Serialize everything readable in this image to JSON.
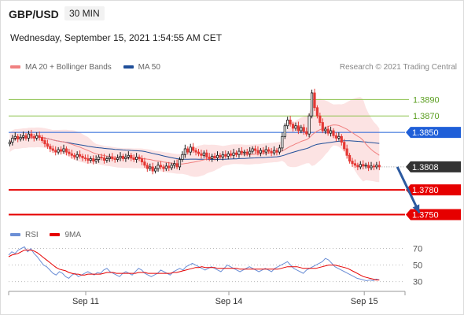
{
  "header": {
    "symbol": "GBP/USD",
    "timeframe": "30 MIN",
    "datetime": "Wednesday, September 15, 2021 1:54:55 AM CET",
    "credit": "Research © 2021 Trading Central"
  },
  "colors": {
    "bollinger_band": "#f9c0c0",
    "ma20": "#f08080",
    "ma50": "#1f4e99",
    "resistance": "#8cc14c",
    "pivot": "#1f5fd8",
    "support": "#e60000",
    "last_price": "#333333",
    "rsi": "#6c8fd6",
    "rsi_ma": "#e60000",
    "arrow": "#2c5aa0",
    "candle_up": "#1a1a1a",
    "candle_down": "#e53935"
  },
  "chart_data": [
    {
      "type": "line",
      "chart": "price",
      "kind": "candlestick",
      "legend": [
        {
          "name": "MA 20 + Bollinger Bands",
          "color": "#f08080"
        },
        {
          "name": "MA 50",
          "color": "#1f4e99"
        }
      ],
      "x_ticks": [
        {
          "label": "Sep 11",
          "t": 70
        },
        {
          "label": "Sep 14",
          "t": 200
        },
        {
          "label": "Sep 15",
          "t": 323
        }
      ],
      "t_range": [
        0,
        360
      ],
      "ylim": [
        1.3738,
        1.392
      ],
      "close": [
        1.3838,
        1.3843,
        1.3845,
        1.3842,
        1.3844,
        1.3846,
        1.3843,
        1.3848,
        1.3845,
        1.3843,
        1.3846,
        1.3844,
        1.384,
        1.3836,
        1.3833,
        1.383,
        1.3828,
        1.3826,
        1.3829,
        1.3827,
        1.383,
        1.3826,
        1.3824,
        1.3822,
        1.382,
        1.3823,
        1.3821,
        1.3819,
        1.3818,
        1.3816,
        1.3818,
        1.3815,
        1.3817,
        1.382,
        1.3819,
        1.3816,
        1.3818,
        1.382,
        1.3818,
        1.3817,
        1.3819,
        1.3821,
        1.3818,
        1.382,
        1.3822,
        1.3819,
        1.3817,
        1.382,
        1.3818,
        1.3814,
        1.381,
        1.3806,
        1.3808,
        1.3803,
        1.3806,
        1.381,
        1.3808,
        1.3806,
        1.3809,
        1.3807,
        1.381,
        1.3812,
        1.3808,
        1.3817,
        1.3823,
        1.383,
        1.3826,
        1.3832,
        1.3828,
        1.3826,
        1.3824,
        1.3822,
        1.3825,
        1.382,
        1.3818,
        1.3821,
        1.3819,
        1.3822,
        1.382,
        1.3823,
        1.3821,
        1.3824,
        1.3822,
        1.3825,
        1.3823,
        1.3827,
        1.3825,
        1.3826,
        1.3824,
        1.3827,
        1.383,
        1.3828,
        1.3825,
        1.3828,
        1.3826,
        1.3829,
        1.3827,
        1.3825,
        1.3828,
        1.3826,
        1.3831,
        1.3845,
        1.3858,
        1.3865,
        1.386,
        1.3855,
        1.3858,
        1.3852,
        1.3856,
        1.3851,
        1.3848,
        1.387,
        1.3898,
        1.388,
        1.387,
        1.3862,
        1.3852,
        1.3854,
        1.3849,
        1.3852,
        1.3846,
        1.3843,
        1.3845,
        1.3838,
        1.383,
        1.3822,
        1.3815,
        1.3812,
        1.381,
        1.3808,
        1.3811,
        1.3809,
        1.381,
        1.3807,
        1.3809,
        1.3808,
        1.381,
        1.3808
      ],
      "levels": [
        {
          "value": 1.389,
          "label": "1.3890",
          "kind": "resistance"
        },
        {
          "value": 1.387,
          "label": "1.3870",
          "kind": "resistance"
        },
        {
          "value": 1.385,
          "label": "1.3850",
          "kind": "pivot"
        },
        {
          "value": 1.3808,
          "label": "1.3808",
          "kind": "last"
        },
        {
          "value": 1.378,
          "label": "1.3780",
          "kind": "support"
        },
        {
          "value": 1.375,
          "label": "1.3750",
          "kind": "support"
        }
      ],
      "forecast_arrow": {
        "from": {
          "t": 353,
          "y": 1.3808
        },
        "to": {
          "t": 373,
          "y": 1.3752
        }
      }
    },
    {
      "type": "line",
      "chart": "rsi",
      "legend": [
        {
          "name": "RSI",
          "color": "#6c8fd6"
        },
        {
          "name": "9MA",
          "color": "#e60000"
        }
      ],
      "ylim": [
        22,
        80
      ],
      "y_ticks": [
        70,
        50,
        30
      ],
      "rsi": [
        62,
        66,
        64,
        68,
        70,
        72,
        66,
        70,
        64,
        60,
        55,
        50,
        48,
        44,
        40,
        38,
        42,
        40,
        36,
        34,
        38,
        40,
        36,
        38,
        40,
        42,
        40,
        38,
        41,
        40,
        44,
        46,
        42,
        40,
        38,
        36,
        40,
        42,
        40,
        38,
        42,
        46,
        44,
        40,
        38,
        36,
        38,
        40,
        44,
        42,
        40,
        38,
        42,
        44,
        46,
        44,
        48,
        50,
        52,
        50,
        48,
        46,
        44,
        46,
        48,
        46,
        44,
        42,
        46,
        50,
        48,
        46,
        44,
        42,
        44,
        46,
        48,
        46,
        44,
        42,
        44,
        46,
        44,
        42,
        46,
        48,
        50,
        52,
        54,
        50,
        46,
        44,
        42,
        40,
        44,
        46,
        48,
        50,
        52,
        54,
        58,
        56,
        52,
        48,
        46,
        44,
        42,
        40,
        38,
        36,
        34,
        33,
        32,
        31,
        32,
        31,
        33,
        32
      ],
      "ma": [
        60,
        62,
        63,
        64,
        66,
        68,
        68,
        68,
        67,
        65,
        62,
        59,
        56,
        53,
        50,
        47,
        45,
        44,
        43,
        41,
        40,
        39,
        39,
        38,
        38,
        39,
        39,
        39,
        39,
        39,
        40,
        41,
        41,
        41,
        40,
        40,
        40,
        40,
        40,
        40,
        40,
        41,
        41,
        41,
        40,
        40,
        40,
        40,
        40,
        40,
        40,
        40,
        41,
        41,
        42,
        43,
        44,
        45,
        46,
        47,
        47,
        48,
        47,
        47,
        47,
        47,
        46,
        46,
        46,
        46,
        46,
        46,
        46,
        45,
        45,
        45,
        45,
        45,
        45,
        45,
        45,
        45,
        45,
        45,
        45,
        45,
        46,
        47,
        48,
        48,
        48,
        48,
        47,
        46,
        46,
        46,
        46,
        46,
        47,
        48,
        49,
        50,
        50,
        50,
        49,
        48,
        47,
        46,
        44,
        42,
        40,
        38,
        36,
        35,
        34,
        33,
        32,
        32
      ]
    }
  ]
}
